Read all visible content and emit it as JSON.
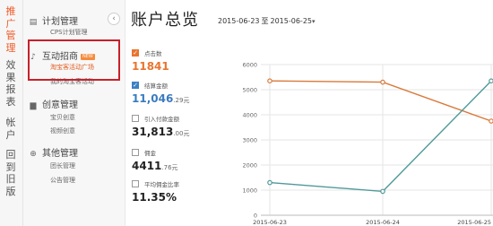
{
  "rail": {
    "items": [
      {
        "label": "推广管理",
        "active": true
      },
      {
        "label": "效果报表",
        "active": false
      },
      {
        "label": "帐户",
        "active": false
      },
      {
        "label": "回到旧版",
        "active": false
      }
    ]
  },
  "sidebar": {
    "collapse_icon": "chevron-left-icon",
    "groups": [
      {
        "label": "计划管理",
        "icon": "clipboard-icon",
        "subs": [
          {
            "label": "CPS计划管理"
          }
        ]
      },
      {
        "label": "互动招商",
        "icon": "megaphone-icon",
        "badge": "NEW",
        "subs": [
          {
            "label": "淘宝客活动广场",
            "active": true
          },
          {
            "label": "我的淘宝客活动"
          }
        ]
      },
      {
        "label": "创意管理",
        "icon": "trash-icon",
        "subs": [
          {
            "label": "宝贝创意"
          },
          {
            "label": "视频创意"
          }
        ]
      },
      {
        "label": "其他管理",
        "icon": "plus-circle-icon",
        "subs": [
          {
            "label": "团长管理"
          },
          {
            "label": "公告管理"
          }
        ]
      }
    ]
  },
  "header": {
    "title": "账户总览",
    "date_start": "2015-06-23",
    "date_sep": "至",
    "date_end": "2015-06-25"
  },
  "metrics": [
    {
      "label": "点击数",
      "value": "11841",
      "unit": "",
      "checked": true,
      "color": "#e9742f"
    },
    {
      "label": "结算金额",
      "value": "11,046",
      "unit": ".29元",
      "checked": true,
      "color": "#3a7cc0"
    },
    {
      "label": "引入付款金额",
      "value": "31,813",
      "unit": ".00元",
      "checked": false,
      "color": "#222222"
    },
    {
      "label": "佣金",
      "value": "4411",
      "unit": ".76元",
      "checked": false,
      "color": "#222222"
    },
    {
      "label": "平均佣金比率",
      "value": "11.35%",
      "unit": "",
      "checked": false,
      "color": "#222222"
    }
  ],
  "chart_data": {
    "type": "line",
    "x": [
      "2015-06-23",
      "2015-06-24",
      "2015-06-25"
    ],
    "y_ticks": [
      0,
      1000,
      2000,
      3000,
      4000,
      5000,
      6000
    ],
    "ylim": [
      0,
      6000
    ],
    "series": [
      {
        "values": [
          5350,
          5300,
          3750
        ],
        "color": "#d9793a"
      },
      {
        "values": [
          1300,
          950,
          5350
        ],
        "color": "#4f9a98"
      }
    ],
    "grid": true
  }
}
